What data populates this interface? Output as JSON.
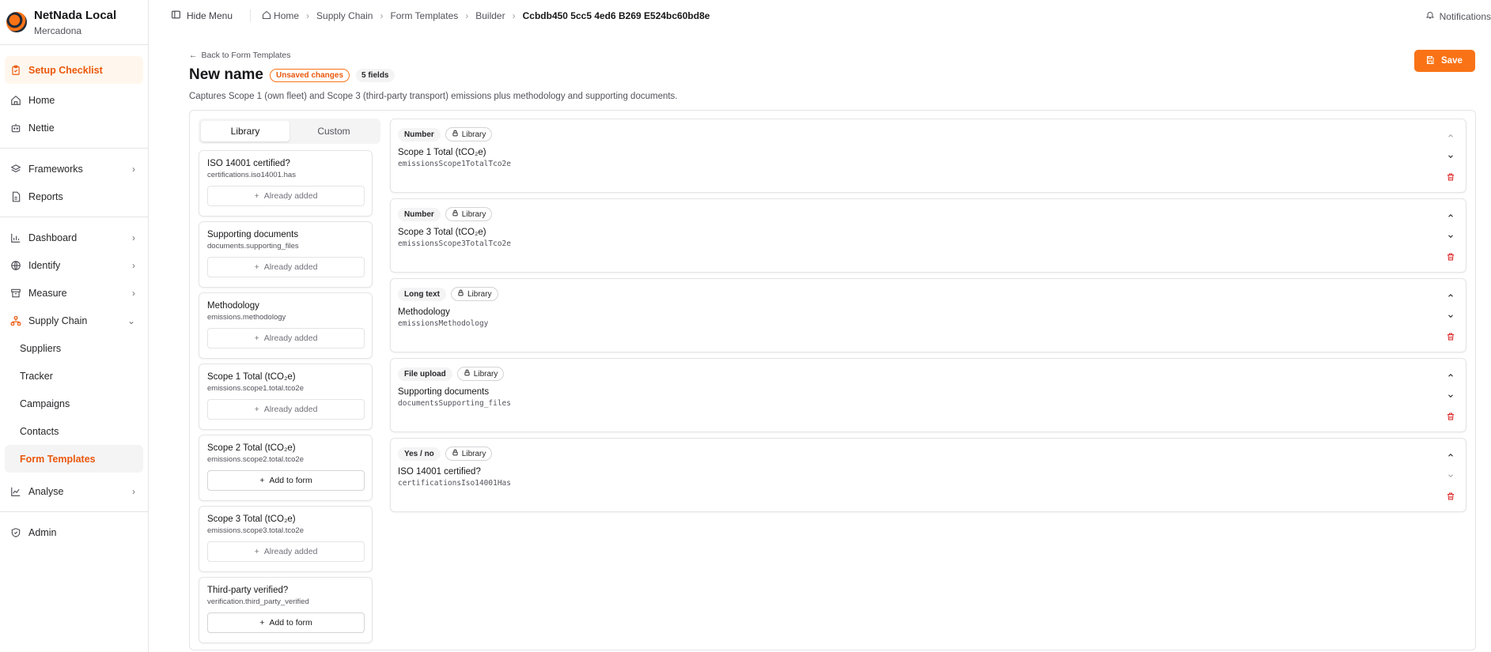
{
  "brand": {
    "name": "NetNada Local",
    "org": "Mercadona"
  },
  "sidebar": {
    "setup": "Setup Checklist",
    "top": [
      {
        "label": "Home",
        "icon": "home-icon"
      },
      {
        "label": "Nettie",
        "icon": "bot-icon"
      }
    ],
    "mid": [
      {
        "label": "Frameworks",
        "icon": "layers-icon"
      },
      {
        "label": "Reports",
        "icon": "file-icon"
      }
    ],
    "groups": [
      {
        "label": "Dashboard",
        "icon": "chart-icon"
      },
      {
        "label": "Identify",
        "icon": "globe-icon"
      },
      {
        "label": "Measure",
        "icon": "archive-icon"
      },
      {
        "label": "Supply Chain",
        "icon": "network-icon"
      }
    ],
    "supply_chain_items": [
      "Suppliers",
      "Tracker",
      "Campaigns",
      "Contacts",
      "Form Templates"
    ],
    "analyse": "Analyse",
    "admin": "Admin"
  },
  "topbar": {
    "hide_menu": "Hide Menu",
    "breadcrumbs": [
      "Home",
      "Supply Chain",
      "Form Templates",
      "Builder",
      "Ccbdb450 5cc5 4ed6 B269 E524bc60bd8e"
    ],
    "notifications": "Notifications"
  },
  "header": {
    "back": "Back to Form Templates",
    "title": "New name",
    "unsaved": "Unsaved changes",
    "fields_count": "5 fields",
    "subtitle": "Captures Scope 1 (own fleet) and Scope 3 (third-party transport) emissions plus methodology and supporting documents.",
    "save": "Save"
  },
  "library": {
    "tabs": [
      "Library",
      "Custom"
    ],
    "items": [
      {
        "name": "ISO 14001 certified?",
        "key": "certifications.iso14001.has",
        "action": "Already added"
      },
      {
        "name": "Supporting documents",
        "key": "documents.supporting_files",
        "action": "Already added"
      },
      {
        "name": "Methodology",
        "key": "emissions.methodology",
        "action": "Already added"
      },
      {
        "name": "Scope 1 Total (tCO₂e)",
        "key": "emissions.scope1.total.tco2e",
        "action": "Already added"
      },
      {
        "name": "Scope 2 Total (tCO₂e)",
        "key": "emissions.scope2.total.tco2e",
        "action": "Add to form"
      },
      {
        "name": "Scope 3 Total (tCO₂e)",
        "key": "emissions.scope3.total.tco2e",
        "action": "Already added"
      },
      {
        "name": "Third-party verified?",
        "key": "verification.third_party_verified",
        "action": "Add to form"
      }
    ]
  },
  "fields": [
    {
      "type": "Number",
      "source": "Library",
      "label": "Scope 1 Total (tCO₂e)",
      "key": "emissionsScope1TotalTco2e"
    },
    {
      "type": "Number",
      "source": "Library",
      "label": "Scope 3 Total (tCO₂e)",
      "key": "emissionsScope3TotalTco2e"
    },
    {
      "type": "Long text",
      "source": "Library",
      "label": "Methodology",
      "key": "emissionsMethodology"
    },
    {
      "type": "File upload",
      "source": "Library",
      "label": "Supporting documents",
      "key": "documentsSupporting_files"
    },
    {
      "type": "Yes / no",
      "source": "Library",
      "label": "ISO 14001 certified?",
      "key": "certificationsIso14001Has"
    }
  ],
  "colors": {
    "accent": "#f97316",
    "danger": "#dc2626"
  }
}
